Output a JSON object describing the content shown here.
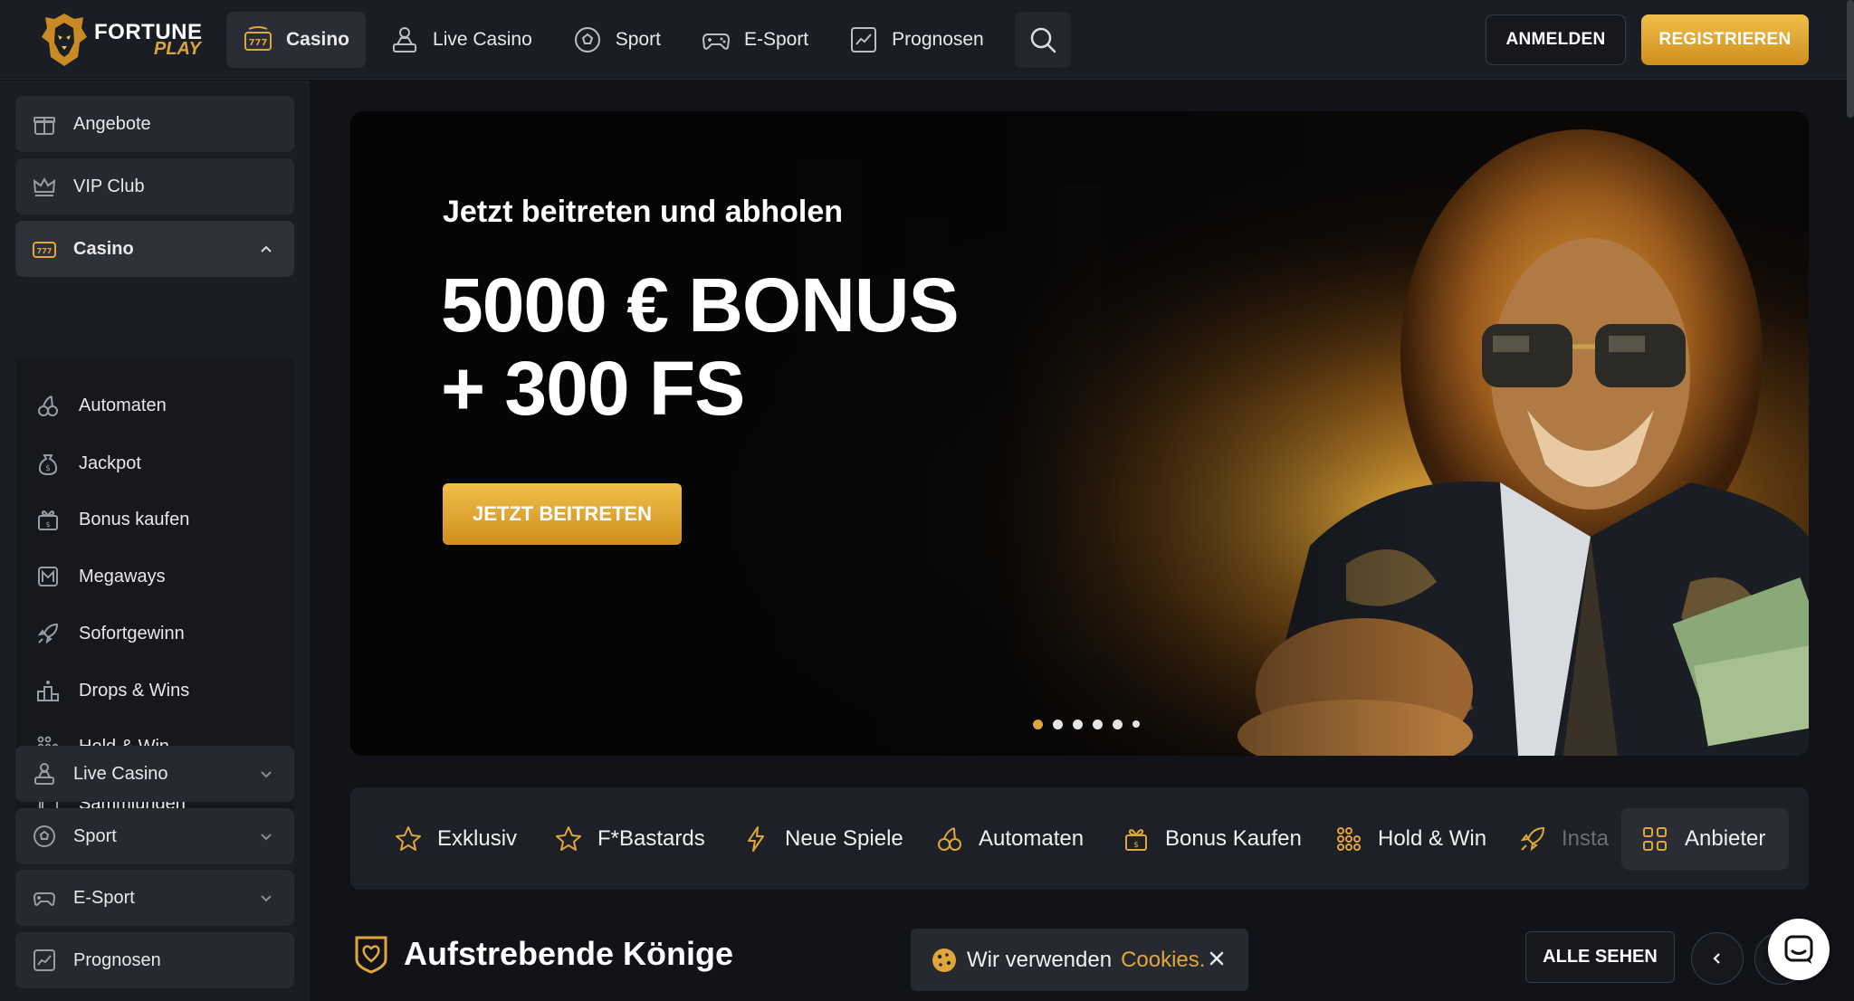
{
  "header": {
    "logo_line1": "FORTUNE",
    "logo_line2": "PLAY",
    "nav": [
      {
        "label": "Casino",
        "icon": "slot-777-icon",
        "active": true
      },
      {
        "label": "Live Casino",
        "icon": "dealer-icon",
        "active": false
      },
      {
        "label": "Sport",
        "icon": "soccer-ball-icon",
        "active": false
      },
      {
        "label": "E-Sport",
        "icon": "gamepad-icon",
        "active": false
      },
      {
        "label": "Prognosen",
        "icon": "chart-icon",
        "active": false
      }
    ],
    "search_icon": "search-icon",
    "login_label": "ANMELDEN",
    "register_label": "REGISTRIEREN"
  },
  "sidebar": {
    "top_items": [
      {
        "label": "Angebote",
        "icon": "gift-icon"
      },
      {
        "label": "VIP Club",
        "icon": "crown-icon"
      }
    ],
    "casino": {
      "label": "Casino",
      "icon": "slot-777-icon",
      "expanded": true
    },
    "casino_children": [
      {
        "label": "Automaten",
        "icon": "cherries-icon"
      },
      {
        "label": "Jackpot",
        "icon": "money-bag-icon"
      },
      {
        "label": "Bonus kaufen",
        "icon": "gift-buy-icon"
      },
      {
        "label": "Megaways",
        "icon": "megaways-icon"
      },
      {
        "label": "Sofortgewinn",
        "icon": "rocket-icon"
      },
      {
        "label": "Drops & Wins",
        "icon": "podium-icon"
      },
      {
        "label": "Hold & Win",
        "icon": "dots-grid-icon"
      },
      {
        "label": "Sammlungen",
        "icon": "collections-icon"
      }
    ],
    "bottom_items": [
      {
        "label": "Live Casino",
        "icon": "dealer-icon",
        "chevron": true
      },
      {
        "label": "Sport",
        "icon": "soccer-ball-icon",
        "chevron": true
      },
      {
        "label": "E-Sport",
        "icon": "gamepad-icon",
        "chevron": true
      },
      {
        "label": "Prognosen",
        "icon": "chart-icon",
        "chevron": false
      }
    ]
  },
  "hero": {
    "pre_title": "Jetzt beitreten und abholen",
    "title_line1": "5000 € BONUS",
    "title_line2": "+ 300 FS",
    "cta_label": "JETZT BEITRETEN",
    "slides_total": 6,
    "active_slide": 1
  },
  "categories": [
    {
      "label": "Exklusiv",
      "icon": "star-icon"
    },
    {
      "label": "F*Bastards",
      "icon": "star-icon"
    },
    {
      "label": "Neue Spiele",
      "icon": "lightning-icon"
    },
    {
      "label": "Automaten",
      "icon": "cherries-icon"
    },
    {
      "label": "Bonus Kaufen",
      "icon": "gift-buy-icon"
    },
    {
      "label": "Hold & Win",
      "icon": "dots-grid-icon"
    },
    {
      "label": "Insta",
      "icon": "rocket-icon"
    }
  ],
  "providers_label": "Anbieter",
  "section": {
    "title": "Aufstrebende Könige",
    "all_label": "ALLE SEHEN"
  },
  "cookie": {
    "text": "Wir verwenden",
    "link": "Cookies."
  },
  "colors": {
    "accent": "#e0a63a",
    "background": "#111318",
    "panel": "#1b1d24"
  }
}
